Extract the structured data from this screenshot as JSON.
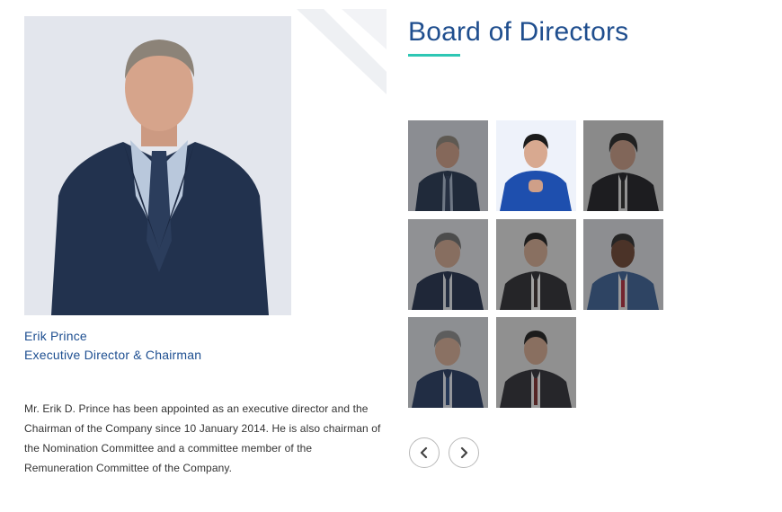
{
  "heading": "Board of Directors",
  "featured": {
    "name": "Erik Prince",
    "title": "Executive Director & Chairman",
    "bio": "Mr. Erik D. Prince has been appointed as an executive director and the Chairman of the Company since 10 January 2014. He is also chairman of the Nomination Committee and a committee member of the Remuneration Committee of the Company."
  },
  "colors": {
    "accent": "#2ec7b4",
    "brand": "#1f4e8e"
  },
  "directors": [
    {
      "active": false
    },
    {
      "active": true
    },
    {
      "active": false
    },
    {
      "active": false
    },
    {
      "active": false
    },
    {
      "active": false
    },
    {
      "active": false
    },
    {
      "active": false
    }
  ],
  "navigation": {
    "prev_icon": "chevron-left-icon",
    "next_icon": "chevron-right-icon"
  }
}
